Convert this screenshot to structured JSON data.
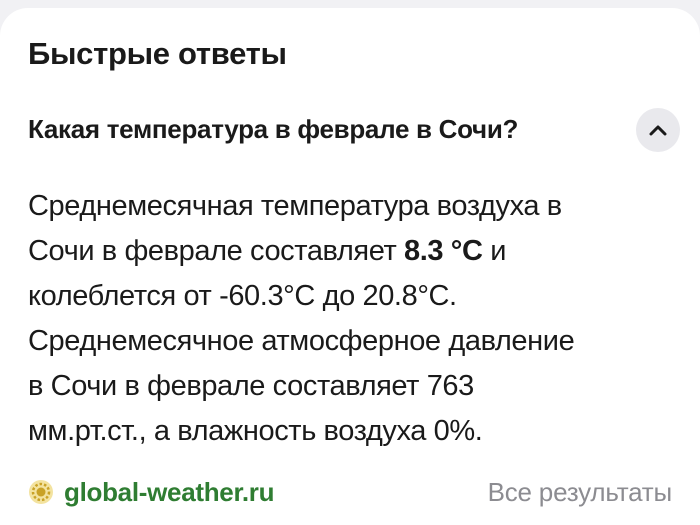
{
  "section_title": "Быстрые ответы",
  "question": "Какая температура в феврале в Сочи?",
  "collapse_icon": "chevron-up-icon",
  "answer": {
    "line1": "Среднемесячная температура воздуха в",
    "line2_pre": "Сочи в феврале составляет ",
    "line2_bold": "8.3 °C",
    "line2_post": " и",
    "line3": "колеблется от -60.3°C до 20.8°C.",
    "line4": "Среднемесячное атмосферное давление",
    "line5": "в Сочи в феврале составляет 763",
    "line6": "мм.рт.ст., а влажность воздуха 0%."
  },
  "source": {
    "icon": "sun-favicon-icon",
    "label": "global-weather.ru"
  },
  "all_results_label": "Все результаты",
  "colors": {
    "source_green": "#2f7d32",
    "muted_text": "#8c8c91",
    "icon_sun": "#c9a227"
  }
}
